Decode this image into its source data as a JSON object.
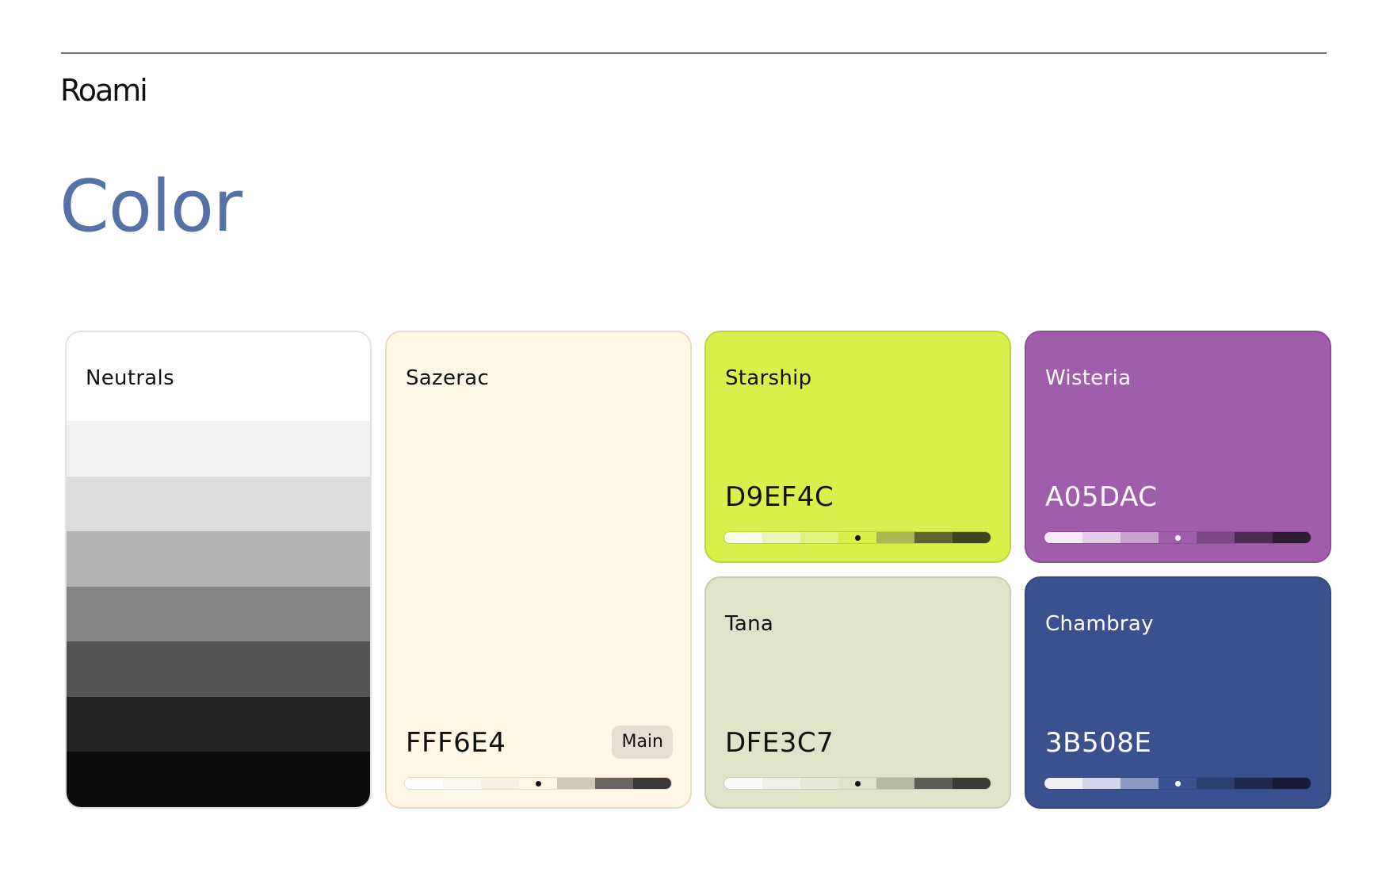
{
  "header": {
    "brand": "Roami"
  },
  "title": {
    "text": "Color",
    "color": "#5472A8"
  },
  "cards": {
    "neutrals": {
      "name": "Neutrals",
      "shades": [
        "#FFFFFF",
        "#F1F1F1",
        "#DBDBDB",
        "#B3B3B3",
        "#858585",
        "#555555",
        "#242424",
        "#0C0C0C"
      ]
    },
    "sazerac": {
      "name": "Sazerac",
      "hex": "FFF6E4",
      "badge": "Main",
      "base": "#FFF6E4",
      "border": "#E8DCC2",
      "text": "#111111",
      "badge_bg": "#E6DFCF",
      "scale": [
        "#FEFEFC",
        "#FBF7EE",
        "#F7F0E0",
        "#FFF6E4",
        "#D1C8B7",
        "#6B6660",
        "#3A3936"
      ],
      "dot": "#111111"
    },
    "starship": {
      "name": "Starship",
      "hex": "D9EF4C",
      "base": "#D9EF4C",
      "border": "#BFD33D",
      "text": "#111111",
      "scale": [
        "#F8FBE8",
        "#EBF5B9",
        "#E0F280",
        "#D9EF4C",
        "#A9B654",
        "#5F6631",
        "#3E4421"
      ],
      "dot": "#111111"
    },
    "wisteria": {
      "name": "Wisteria",
      "hex": "A05DAC",
      "base": "#A05DAC",
      "border": "#8B4E97",
      "text": "#FFFFFF",
      "scale": [
        "#F5EDF6",
        "#E3CFE6",
        "#C9A3CF",
        "#A05DAC",
        "#7C4887",
        "#4A2C52",
        "#2E1B34"
      ],
      "dot": "#FFFFFF"
    },
    "tana": {
      "name": "Tana",
      "hex": "DFE3C7",
      "base": "#DFE3C7",
      "border": "#C8CDAE",
      "text": "#111111",
      "scale": [
        "#FAFBF5",
        "#F0F2E6",
        "#E6E9D5",
        "#DFE3C7",
        "#B5B9A2",
        "#5C5F52",
        "#3A3C34"
      ],
      "dot": "#111111"
    },
    "chambray": {
      "name": "Chambray",
      "hex": "3B508E",
      "base": "#3B508E",
      "border": "#33467D",
      "text": "#FFFFFF",
      "scale": [
        "#EDF0F7",
        "#D0D7E9",
        "#8B98C2",
        "#3B508E",
        "#2E3F72",
        "#1D2850",
        "#151C38"
      ],
      "dot": "#FFFFFF"
    }
  }
}
